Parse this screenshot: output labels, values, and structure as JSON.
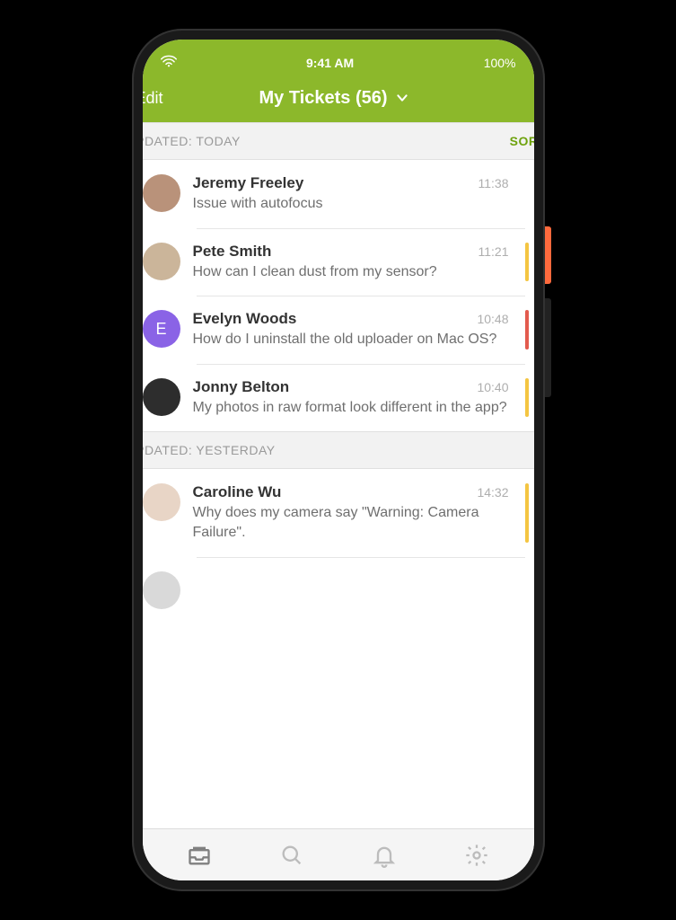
{
  "status": {
    "time": "9:41 AM",
    "battery": "100%"
  },
  "topbar": {
    "edit": "Edit",
    "title": "My Tickets (56)"
  },
  "sections": [
    {
      "label": "UPDATED: TODAY",
      "sort": "SORT",
      "items": [
        {
          "name": "Jeremy Freeley",
          "subject": "Issue with autofocus",
          "time": "11:38",
          "avatar_bg": "#b9927a",
          "flag": ""
        },
        {
          "name": "Pete Smith",
          "subject": "How can I clean dust from my sensor?",
          "time": "11:21",
          "avatar_bg": "#cbb59a",
          "flag": "#f4c542"
        },
        {
          "name": "Evelyn Woods",
          "subject": "How do I uninstall the old uploader on Mac OS?",
          "time": "10:48",
          "avatar_letter": "E",
          "flag": "#e35b4e"
        },
        {
          "name": "Jonny Belton",
          "subject": "My photos in raw format look different in the app?",
          "time": "10:40",
          "avatar_bg": "#2d2d2d",
          "flag": "#f4c542"
        }
      ]
    },
    {
      "label": "UPDATED: YESTERDAY",
      "sort": "",
      "items": [
        {
          "name": "Caroline Wu",
          "subject": "Why does my camera say \"Warning: Camera Failure\".",
          "time": "14:32",
          "avatar_bg": "#e8d5c6",
          "flag": "#f4c542"
        }
      ]
    }
  ]
}
